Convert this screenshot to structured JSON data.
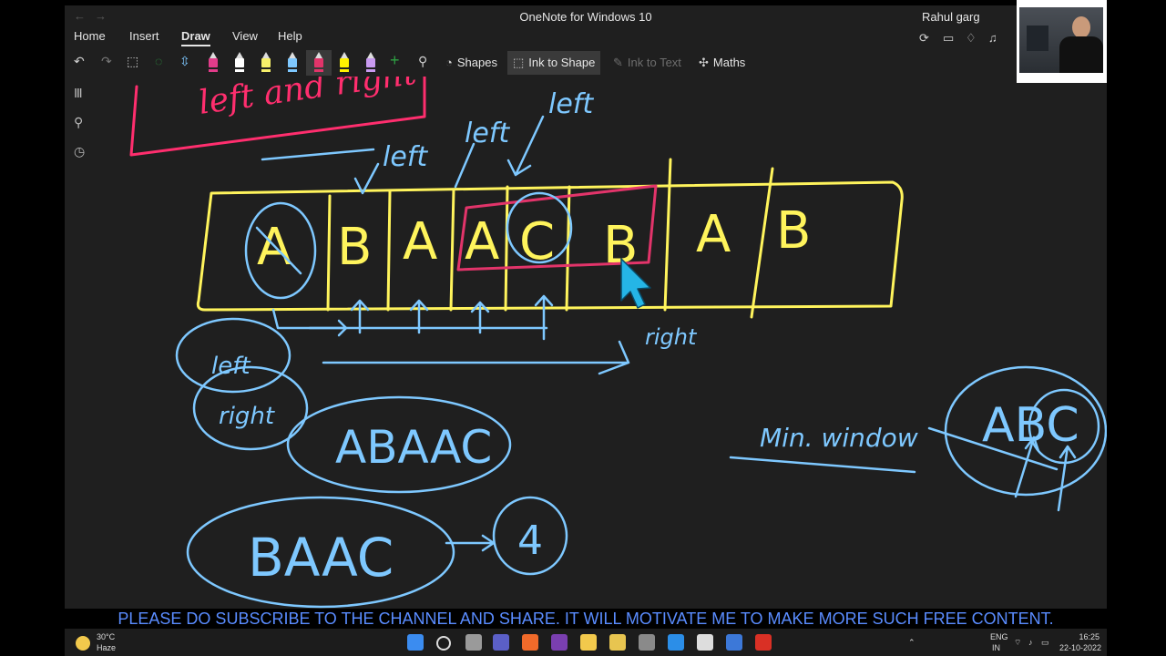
{
  "titlebar": {
    "title": "OneNote for Windows 10",
    "user": "Rahul garg",
    "back": "←",
    "forward": "→"
  },
  "tabs": [
    "Home",
    "Insert",
    "Draw",
    "View",
    "Help"
  ],
  "active_tab": "Draw",
  "toolbar": {
    "undo": "↶",
    "redo": "↷",
    "lasso": "⬚",
    "eraser": "◌",
    "add_pen": "+",
    "shapes": "Shapes",
    "ink_to_shape": "Ink to Shape",
    "ink_to_text": "Ink to Text",
    "maths": "Maths",
    "pens": [
      {
        "color": "#e23c8a"
      },
      {
        "color": "#ffffff"
      },
      {
        "color": "#f7ef6a"
      },
      {
        "color": "#7ec8ff"
      },
      {
        "color": "#e2346a"
      },
      {
        "color": "#fff200"
      },
      {
        "color": "#c89af0"
      }
    ]
  },
  "sidebar_icons": [
    "notebooks-icon",
    "search-icon",
    "recent-icon"
  ],
  "ink": {
    "red_box_text": "left and right",
    "arrows": [
      "left",
      "left",
      "left"
    ],
    "cells": [
      "A",
      "B",
      "A",
      "A",
      "C",
      "B",
      "A",
      "B"
    ],
    "right_label": "right",
    "left_circle": "left",
    "right_circle": "right",
    "word1": "ABAAC",
    "word2": "BAAC",
    "count": "4",
    "min_window": "Min. window",
    "abc": "ABC"
  },
  "banner": "PLEASE DO SUBSCRIBE TO THE CHANNEL AND SHARE. IT WILL MOTIVATE ME TO MAKE MORE SUCH FREE CONTENT.",
  "taskbar": {
    "temp": "30°C",
    "weather": "Haze",
    "lang1": "ENG",
    "lang2": "IN",
    "time": "16:25",
    "date": "22-10-2022"
  },
  "colors": {
    "ink_yellow": "#fff45c",
    "ink_blue": "#7ec8ff",
    "ink_red": "#e2346a",
    "ink_pink": "#ff3b7a",
    "banner": "#5a8cff"
  }
}
